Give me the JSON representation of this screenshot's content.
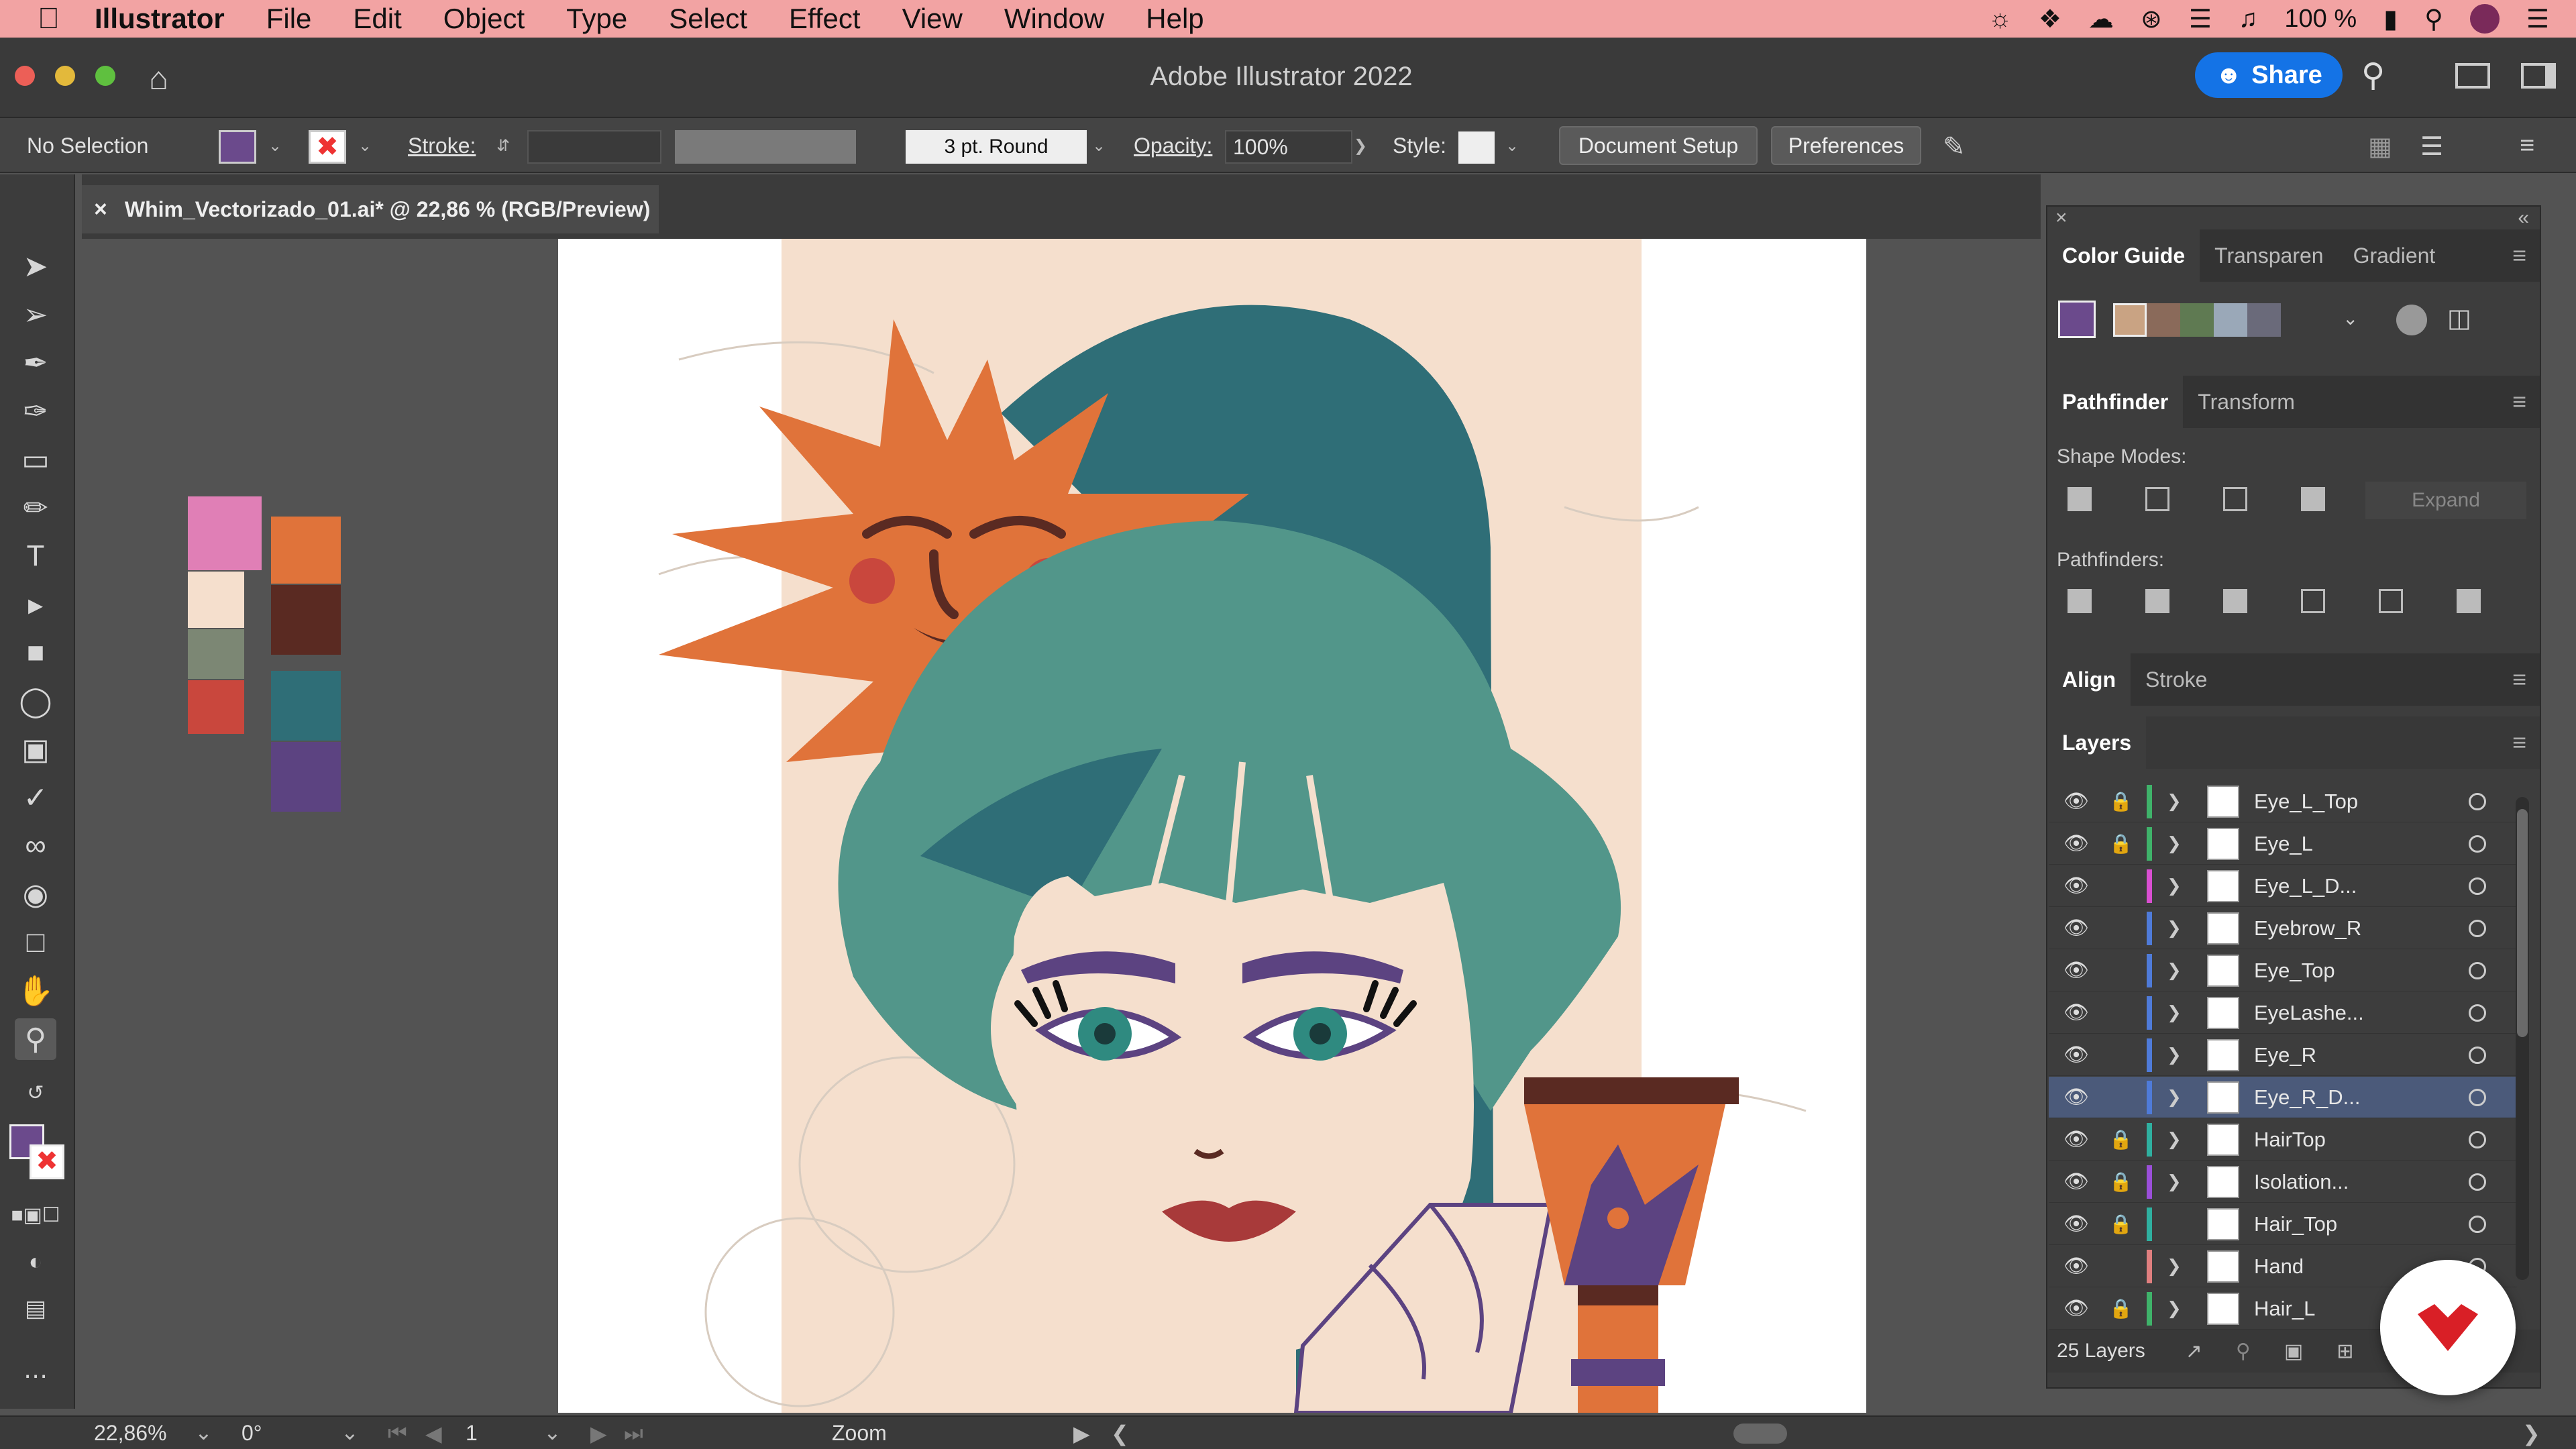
{
  "menubar": {
    "app": "Illustrator",
    "items": [
      "File",
      "Edit",
      "Object",
      "Type",
      "Select",
      "Effect",
      "View",
      "Window",
      "Help"
    ],
    "battery": "100 %"
  },
  "window": {
    "title": "Adobe Illustrator 2022",
    "share_label": "Share"
  },
  "control_bar": {
    "selection": "No Selection",
    "stroke_label": "Stroke:",
    "brush": "3 pt. Round",
    "opacity_label": "Opacity:",
    "opacity_value": "100%",
    "style_label": "Style:",
    "document_setup": "Document Setup",
    "preferences": "Preferences",
    "fill_color": "#6b4a8c"
  },
  "document": {
    "tab_title": "Whim_Vectorizado_01.ai* @ 22,86 % (RGB/Preview)"
  },
  "swatches": [
    "#e07fb6",
    "#e0733a",
    "#f5dfcd",
    "#5a2a22",
    "#7c8774",
    "#2f6e77",
    "#c9473d",
    "#5c4381"
  ],
  "color_guide": {
    "tabs": [
      "Color Guide",
      "Transparen",
      "Gradient"
    ],
    "harmony": [
      "#8a6a5a",
      "#5f7a52",
      "#9aa8b8",
      "#6a6a7a"
    ]
  },
  "pathfinder": {
    "tabs": [
      "Pathfinder",
      "Transform"
    ],
    "shape_modes_label": "Shape Modes:",
    "pathfinders_label": "Pathfinders:",
    "expand_label": "Expand"
  },
  "align": {
    "tabs": [
      "Align",
      "Stroke"
    ]
  },
  "layers": {
    "title": "Layers",
    "count_label": "25 Layers",
    "items": [
      {
        "name": "Eye_L_Top",
        "locked": true,
        "color": "#3fb36a",
        "expandable": true
      },
      {
        "name": "Eye_L",
        "locked": true,
        "color": "#3fb36a",
        "expandable": true
      },
      {
        "name": "Eye_L_D...",
        "locked": false,
        "color": "#d94fd1",
        "expandable": true
      },
      {
        "name": "Eyebrow_R",
        "locked": false,
        "color": "#4f7bd9",
        "expandable": true
      },
      {
        "name": "Eye_Top",
        "locked": false,
        "color": "#4f7bd9",
        "expandable": true
      },
      {
        "name": "EyeLashe...",
        "locked": false,
        "color": "#4f7bd9",
        "expandable": true
      },
      {
        "name": "Eye_R",
        "locked": false,
        "color": "#4f7bd9",
        "expandable": true
      },
      {
        "name": "Eye_R_D...",
        "locked": false,
        "color": "#4f7bd9",
        "expandable": true,
        "selected": true
      },
      {
        "name": "HairTop",
        "locked": true,
        "color": "#2fb0a0",
        "expandable": true
      },
      {
        "name": "Isolation...",
        "locked": true,
        "color": "#9b4fd9",
        "expandable": true
      },
      {
        "name": "Hair_Top",
        "locked": true,
        "color": "#2fb0a0",
        "expandable": false
      },
      {
        "name": "Hand",
        "locked": false,
        "color": "#e07f7f",
        "expandable": true
      },
      {
        "name": "Hair_L",
        "locked": true,
        "color": "#3fb36a",
        "expandable": true
      }
    ]
  },
  "status_bar": {
    "zoom": "22,86%",
    "rotation": "0°",
    "artboard": "1",
    "tool": "Zoom"
  }
}
